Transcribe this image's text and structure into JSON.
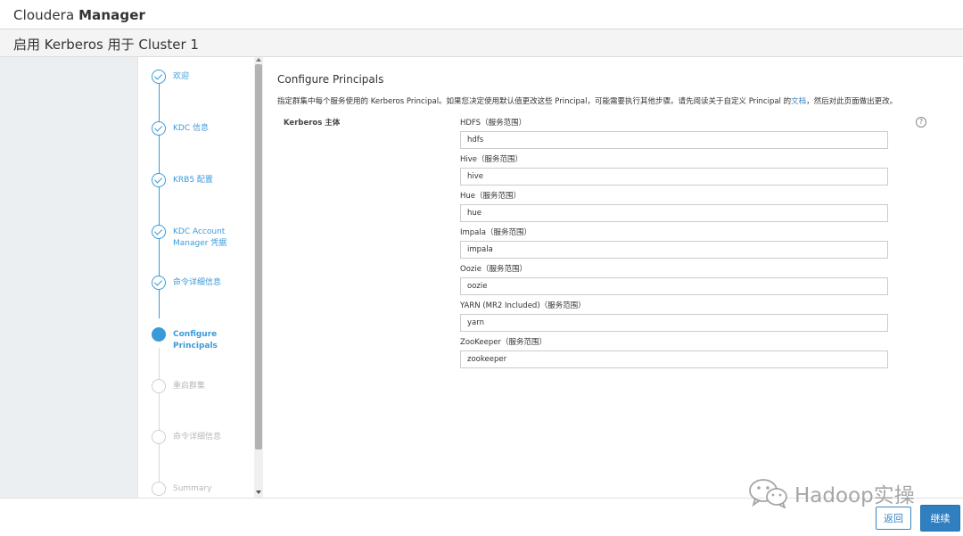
{
  "app": {
    "brand_light": "Cloudera ",
    "brand_bold": "Manager"
  },
  "page": {
    "title": "启用 Kerberos 用于 Cluster 1"
  },
  "wizard": {
    "steps": [
      {
        "label": "欢迎",
        "state": "done"
      },
      {
        "label": "KDC 信息",
        "state": "done"
      },
      {
        "label": "KRB5 配置",
        "state": "done"
      },
      {
        "label": "KDC Account Manager 凭据",
        "state": "done"
      },
      {
        "label": "命令详细信息",
        "state": "done"
      },
      {
        "label": "Configure Principals",
        "state": "active"
      },
      {
        "label": "重启群集",
        "state": "pending"
      },
      {
        "label": "命令详细信息",
        "state": "pending"
      },
      {
        "label": "Summary",
        "state": "pending"
      }
    ]
  },
  "main": {
    "section_title": "Configure Principals",
    "intro_before": "指定群集中每个服务使用的 Kerberos Principal。如果您决定使用默认值更改这些 Principal，可能需要执行其他步骤。请先阅读关于自定义 Principal 的",
    "intro_link": "文档",
    "intro_after": "，然后对此页面做出更改。",
    "row_label": "Kerberos 主体",
    "help_glyph": "?",
    "fields": [
      {
        "label": "HDFS（服务范围）",
        "value": "hdfs"
      },
      {
        "label": "Hive（服务范围）",
        "value": "hive"
      },
      {
        "label": "Hue（服务范围）",
        "value": "hue"
      },
      {
        "label": "Impala（服务范围）",
        "value": "impala"
      },
      {
        "label": "Oozie（服务范围）",
        "value": "oozie"
      },
      {
        "label": "YARN (MR2 Included)（服务范围）",
        "value": "yarn"
      },
      {
        "label": "ZooKeeper（服务范围）",
        "value": "zookeeper"
      }
    ]
  },
  "footer": {
    "back_label": "返回",
    "continue_label": "继续"
  },
  "watermark": {
    "text": "Hadoop实操"
  },
  "colors": {
    "accent": "#3a9bd9",
    "primary_button": "#2f7fc1",
    "pending": "#cfcfcf"
  }
}
